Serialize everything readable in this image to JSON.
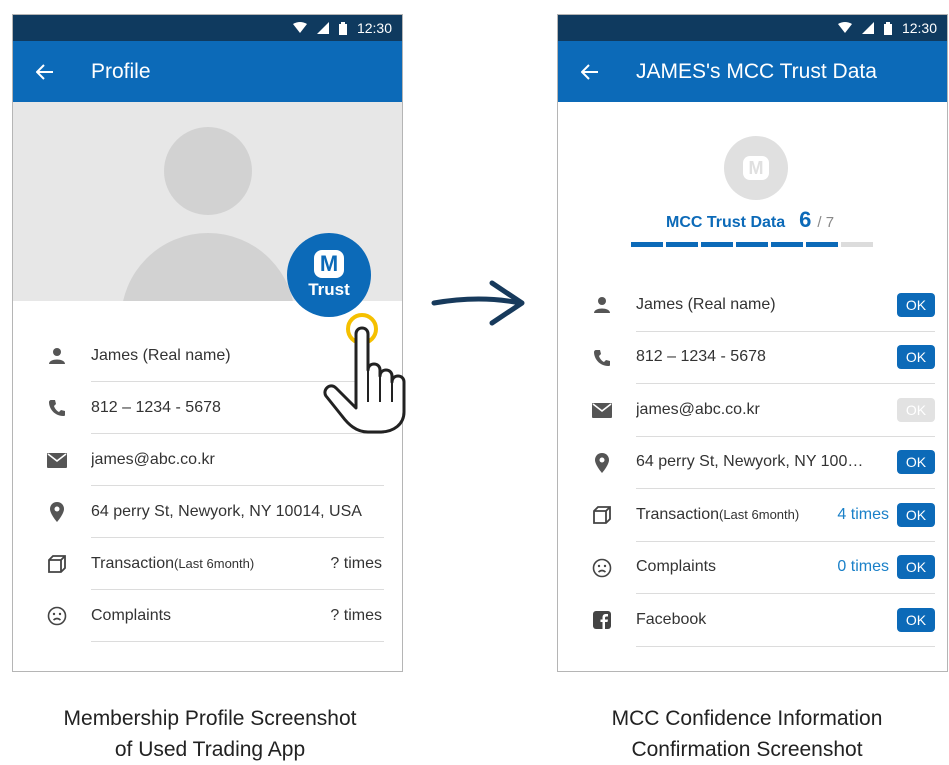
{
  "status_bar": {
    "time": "12:30"
  },
  "left_screen": {
    "title": "Profile",
    "trust_badge": {
      "logo_letter": "M",
      "label": "Trust"
    },
    "rows": [
      {
        "icon": "person-icon",
        "label": "James (Real name)",
        "value": ""
      },
      {
        "icon": "phone-icon",
        "label": "812 – 1234 - 5678",
        "value": ""
      },
      {
        "icon": "mail-icon",
        "label": "james@abc.co.kr",
        "value": ""
      },
      {
        "icon": "location-pin-icon",
        "label": "64 perry St, Newyork, NY 10014, USA",
        "value": ""
      },
      {
        "icon": "box-icon",
        "label": "Transaction",
        "sublabel": "(Last 6month)",
        "value": "? times"
      },
      {
        "icon": "sad-face-icon",
        "label": "Complaints",
        "value": "? times"
      }
    ]
  },
  "right_screen": {
    "title": "JAMES's MCC Trust Data",
    "logo_letter": "M",
    "heading": "MCC Trust Data",
    "score": "6",
    "score_total": "/ 7",
    "progress": {
      "filled": 6,
      "total": 7
    },
    "rows": [
      {
        "icon": "person-icon",
        "label": "James (Real name)",
        "count": "",
        "ok": "OK",
        "ok_enabled": true
      },
      {
        "icon": "phone-icon",
        "label": "812 – 1234 - 5678",
        "count": "",
        "ok": "OK",
        "ok_enabled": true
      },
      {
        "icon": "mail-icon",
        "label": "james@abc.co.kr",
        "count": "",
        "ok": "OK",
        "ok_enabled": false
      },
      {
        "icon": "location-pin-icon",
        "label": "64 perry St, Newyork, NY 100…",
        "count": "",
        "ok": "OK",
        "ok_enabled": true
      },
      {
        "icon": "box-icon",
        "label": "Transaction",
        "sublabel": "(Last 6month)",
        "count": "4 times",
        "ok": "OK",
        "ok_enabled": true
      },
      {
        "icon": "sad-face-icon",
        "label": "Complaints",
        "count": "0 times",
        "ok": "OK",
        "ok_enabled": true
      },
      {
        "icon": "facebook-icon",
        "label": "Facebook",
        "count": "",
        "ok": "OK",
        "ok_enabled": true
      }
    ]
  },
  "captions": {
    "left": [
      "Membership Profile Screenshot",
      "of Used Trading App"
    ],
    "right": [
      "MCC Confidence Information",
      "Confirmation Screenshot"
    ]
  },
  "colors": {
    "appbar": "#0c6ab8",
    "statusbar": "#0f3a5f",
    "ok_disabled": "#e2e2e2",
    "count_text": "#1a80c8"
  }
}
